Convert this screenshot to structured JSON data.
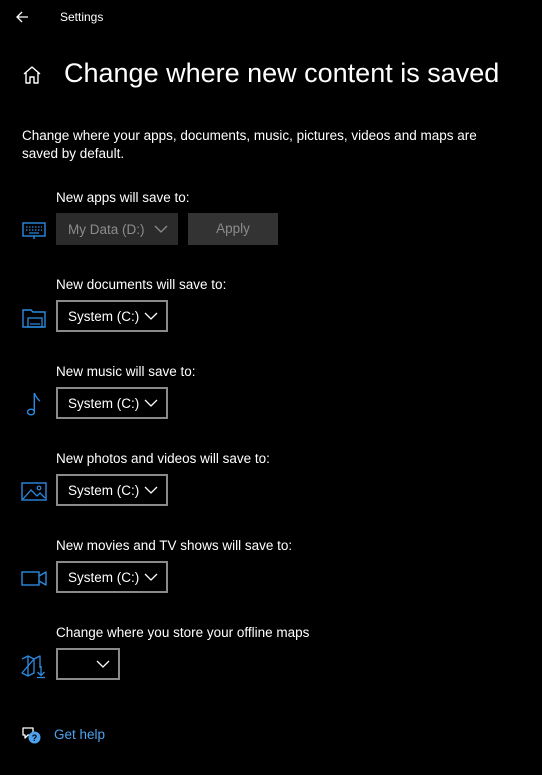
{
  "window": {
    "title": "Settings",
    "back_icon": "back-arrow-icon"
  },
  "header": {
    "home_icon": "home-icon",
    "title": "Change where new content is saved"
  },
  "description": "Change where your apps, documents, music, pictures, videos and maps are saved by default.",
  "colors": {
    "background": "#000000",
    "accent": "#2b8ae0",
    "link": "#4ba3f0",
    "disabled_fill": "#2b2b2b",
    "disabled_text": "#8c8c8c",
    "dropdown_border": "#8a8a8a"
  },
  "rows": [
    {
      "label": "New apps will save to:",
      "icon": "monitor-keyboard-icon",
      "selected": "My Data (D:)",
      "disabled": true,
      "apply_label": "Apply",
      "apply_disabled": true
    },
    {
      "label": "New documents will save to:",
      "icon": "folder-drive-icon",
      "selected": "System (C:)",
      "disabled": false
    },
    {
      "label": "New music will save to:",
      "icon": "music-note-icon",
      "selected": "System (C:)",
      "disabled": false
    },
    {
      "label": "New photos and videos will save to:",
      "icon": "photo-icon",
      "selected": "System (C:)",
      "disabled": false
    },
    {
      "label": "New movies and TV shows will save to:",
      "icon": "video-camera-icon",
      "selected": "System (C:)",
      "disabled": false
    },
    {
      "label": "Change where you store your offline maps",
      "icon": "map-download-icon",
      "selected": "",
      "disabled": false
    }
  ],
  "help": {
    "icon": "help-chat-icon",
    "label": "Get help"
  }
}
